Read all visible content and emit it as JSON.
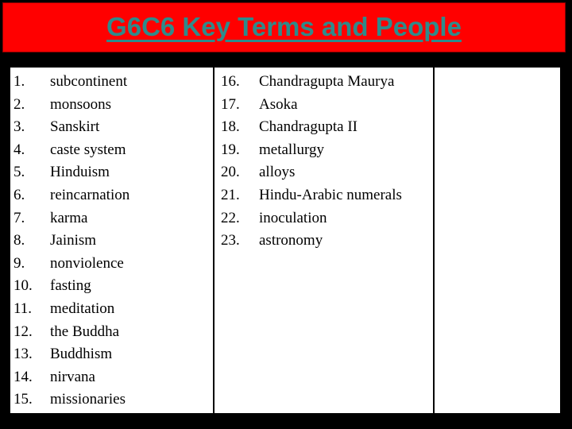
{
  "slide": {
    "title": "G6C6 Key Terms and People",
    "title_color": "#2E8B8B",
    "banner_color": "#FF0000",
    "banner_border_color": "#8B0000",
    "background_color": "#000000",
    "content_background_color": "#FFFFFF"
  },
  "columns": [
    {
      "name": "column-one",
      "items": [
        {
          "number": "1.",
          "label": "subcontinent"
        },
        {
          "number": "2.",
          "label": "monsoons"
        },
        {
          "number": "3.",
          "label": "Sanskirt"
        },
        {
          "number": "4.",
          "label": "caste system"
        },
        {
          "number": "5.",
          "label": "Hinduism"
        },
        {
          "number": "6.",
          "label": "reincarnation"
        },
        {
          "number": "7.",
          "label": "karma"
        },
        {
          "number": "8.",
          "label": "Jainism"
        },
        {
          "number": "9.",
          "label": "nonviolence"
        },
        {
          "number": "10.",
          "label": "fasting"
        },
        {
          "number": "11.",
          "label": "meditation"
        },
        {
          "number": "12.",
          "label": "the Buddha"
        },
        {
          "number": "13.",
          "label": "Buddhism"
        },
        {
          "number": "14.",
          "label": "nirvana"
        },
        {
          "number": "15.",
          "label": "missionaries"
        }
      ]
    },
    {
      "name": "column-two",
      "items": [
        {
          "number": "16.",
          "label": "Chandragupta Maurya"
        },
        {
          "number": "17.",
          "label": "Asoka"
        },
        {
          "number": "18.",
          "label": "Chandragupta II"
        },
        {
          "number": "19.",
          "label": "metallurgy"
        },
        {
          "number": "20.",
          "label": "alloys"
        },
        {
          "number": "21.",
          "label": "Hindu-Arabic numerals"
        },
        {
          "number": "22.",
          "label": "inoculation"
        },
        {
          "number": "23.",
          "label": "astronomy"
        }
      ]
    },
    {
      "name": "column-three",
      "items": []
    }
  ]
}
